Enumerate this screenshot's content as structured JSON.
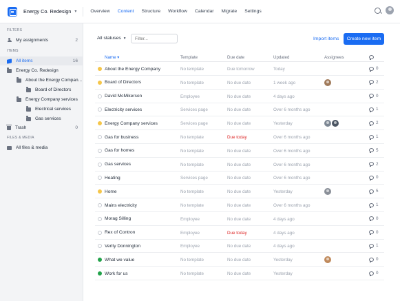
{
  "header": {
    "project_name": "Energy Co. Redesign",
    "nav": [
      {
        "label": "Overview",
        "active": false
      },
      {
        "label": "Content",
        "active": true
      },
      {
        "label": "Structure",
        "active": false
      },
      {
        "label": "Workflow",
        "active": false
      },
      {
        "label": "Calendar",
        "active": false
      },
      {
        "label": "Migrate",
        "active": false
      },
      {
        "label": "Settings",
        "active": false
      }
    ],
    "search_icon": "search-icon",
    "accent_color": "#1a6cf2"
  },
  "sidebar": {
    "filters_heading": "FILTERS",
    "my_assignments": {
      "label": "My assignments",
      "count": "2"
    },
    "items_heading": "ITEMS",
    "all_items": {
      "label": "All items",
      "count": "16"
    },
    "tree": [
      {
        "label": "Energy Co. Redesign",
        "level": 0
      },
      {
        "label": "About the Energy Compan...",
        "level": 1
      },
      {
        "label": "Board of Directors",
        "level": 2
      },
      {
        "label": "Energy Company services",
        "level": 1
      },
      {
        "label": "Electrical services",
        "level": 2
      },
      {
        "label": "Gas services",
        "level": 2
      }
    ],
    "trash": {
      "label": "Trash",
      "count": "0"
    },
    "files_heading": "FILES & MEDIA",
    "all_files": {
      "label": "All files & media"
    }
  },
  "toolbar": {
    "status_select": "All statuses",
    "filter_placeholder": "Filter...",
    "import_label": "Import items",
    "create_label": "Create new item"
  },
  "table": {
    "headers": {
      "name": "Name ▾",
      "template": "Template",
      "due": "Due date",
      "updated": "Updated",
      "assignees": "Assignees"
    },
    "rows": [
      {
        "status": "yellow",
        "name": "About the Energy Company",
        "template": "No template",
        "due": "Due tomorrow",
        "due_red": false,
        "updated": "Today",
        "assignees": [],
        "comments": "0"
      },
      {
        "status": "yellow",
        "name": "Board of Directors",
        "template": "No template",
        "due": "No due date",
        "due_red": false,
        "updated": "1 week ago",
        "assignees": [
          "#a07a5a"
        ],
        "comments": "2"
      },
      {
        "status": "grey",
        "name": "David McMikerson",
        "template": "Employee",
        "due": "No due date",
        "due_red": false,
        "updated": "4 days ago",
        "assignees": [],
        "comments": "0"
      },
      {
        "status": "grey",
        "name": "Electricity services",
        "template": "Services page",
        "due": "No due date",
        "due_red": false,
        "updated": "Over 6 months ago",
        "assignees": [],
        "comments": "1"
      },
      {
        "status": "yellow",
        "name": "Energy Company services",
        "template": "Services page",
        "due": "No due date",
        "due_red": false,
        "updated": "Yesterday",
        "assignees": [
          "#7d8794",
          "#4b5563"
        ],
        "comments": "2"
      },
      {
        "status": "grey",
        "name": "Gas for business",
        "template": "No template",
        "due": "Due today",
        "due_red": true,
        "updated": "Over 6 months ago",
        "assignees": [],
        "comments": "1"
      },
      {
        "status": "grey",
        "name": "Gas for homes",
        "template": "No template",
        "due": "No due date",
        "due_red": false,
        "updated": "Over 6 months ago",
        "assignees": [],
        "comments": "5"
      },
      {
        "status": "grey",
        "name": "Gas services",
        "template": "No template",
        "due": "No due date",
        "due_red": false,
        "updated": "Over 6 months ago",
        "assignees": [],
        "comments": "2"
      },
      {
        "status": "grey",
        "name": "Heating",
        "template": "Services page",
        "due": "No due date",
        "due_red": false,
        "updated": "Over 6 months ago",
        "assignees": [],
        "comments": "0"
      },
      {
        "status": "yellow",
        "name": "Home",
        "template": "No template",
        "due": "No due date",
        "due_red": false,
        "updated": "Yesterday",
        "assignees": [
          "#8a8f98"
        ],
        "comments": "5"
      },
      {
        "status": "grey",
        "name": "Mains electricity",
        "template": "No template",
        "due": "No due date",
        "due_red": false,
        "updated": "Over 6 months ago",
        "assignees": [],
        "comments": "1"
      },
      {
        "status": "grey",
        "name": "Morag Silling",
        "template": "Employee",
        "due": "No due date",
        "due_red": false,
        "updated": "4 days ago",
        "assignees": [],
        "comments": "0"
      },
      {
        "status": "grey",
        "name": "Rex of Contron",
        "template": "Employee",
        "due": "Due today",
        "due_red": true,
        "updated": "4 days ago",
        "assignees": [],
        "comments": "0"
      },
      {
        "status": "grey",
        "name": "Verity Donnington",
        "template": "Employee",
        "due": "No due date",
        "due_red": false,
        "updated": "4 days ago",
        "assignees": [],
        "comments": "1"
      },
      {
        "status": "green",
        "name": "What we value",
        "template": "No template",
        "due": "No due date",
        "due_red": false,
        "updated": "Yesterday",
        "assignees": [
          "#c08a5c"
        ],
        "comments": "0"
      },
      {
        "status": "green",
        "name": "Work for us",
        "template": "No template",
        "due": "No due date",
        "due_red": false,
        "updated": "Yesterday",
        "assignees": [],
        "comments": "0"
      }
    ]
  }
}
